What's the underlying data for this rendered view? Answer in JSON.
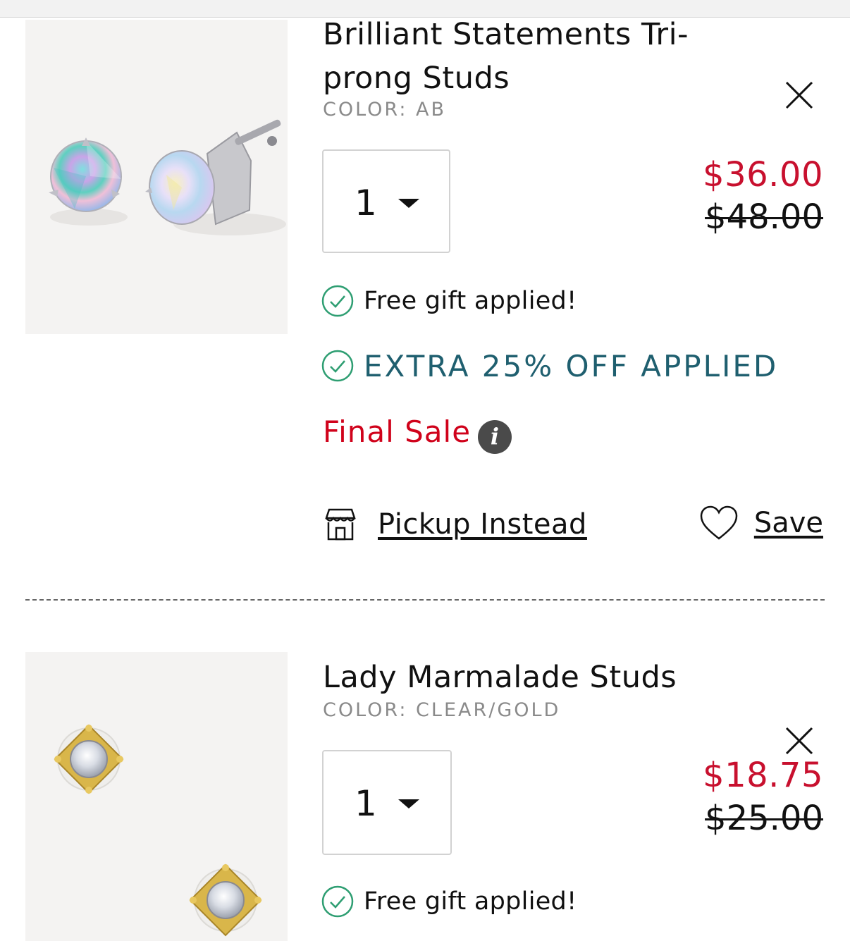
{
  "cart": {
    "items": [
      {
        "name": "Brilliant Statements Tri-prong Studs",
        "color": "COLOR: AB",
        "quantity": "1",
        "price": "$36.00",
        "original_price": "$48.00",
        "gift_label": "Free gift applied!",
        "discount_label": "EXTRA 25% OFF APPLIED",
        "final_sale_label": "Final Sale",
        "info_glyph": "i",
        "pickup_label": "Pickup Instead",
        "save_label": "Save"
      },
      {
        "name": "Lady Marmalade Studs",
        "color": "COLOR: CLEAR/GOLD",
        "quantity": "1",
        "price": "$18.75",
        "original_price": "$25.00",
        "gift_label": "Free gift applied!"
      }
    ]
  },
  "colors": {
    "sale_price": "#c8102e",
    "final_sale": "#d0021b",
    "discount_text": "#1f5f6f",
    "check_green": "#2e9e72"
  },
  "icons": [
    "close-icon",
    "chevron-down-icon",
    "check-circle-icon",
    "info-icon",
    "store-icon",
    "heart-icon"
  ]
}
